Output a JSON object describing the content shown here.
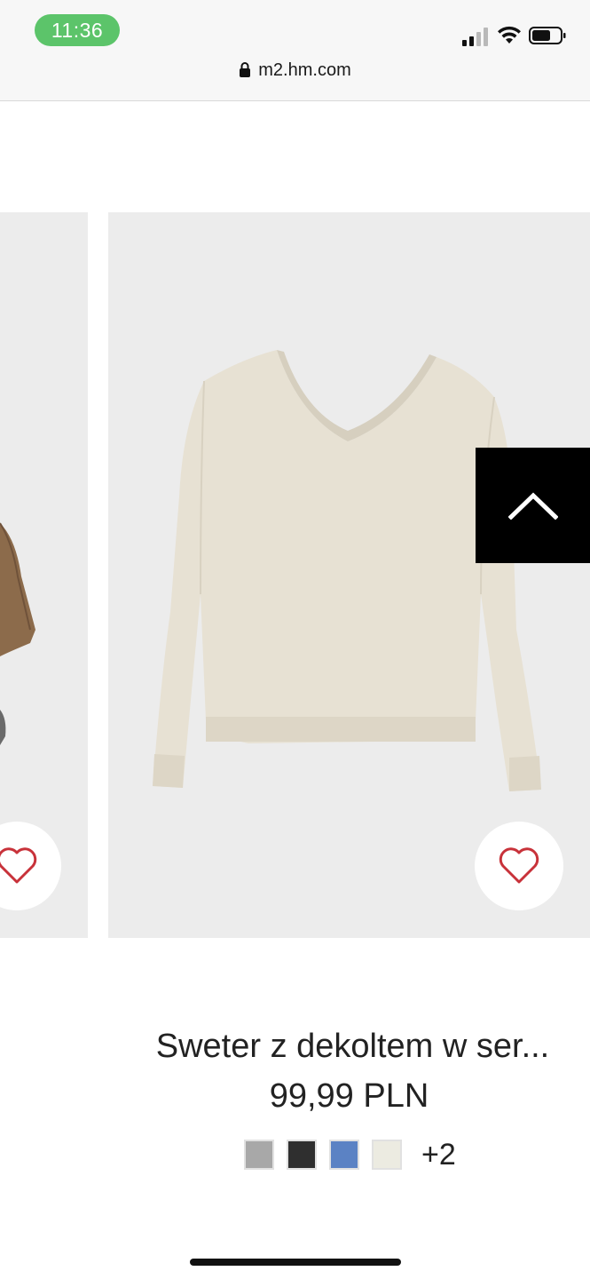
{
  "status_bar": {
    "time": "11:36",
    "url": "m2.hm.com"
  },
  "product": {
    "title": "Sweter z dekoltem w ser...",
    "price": "99,99 PLN",
    "more_colors": "+2",
    "swatch_colors": [
      "#a8a8a8",
      "#2f2f2f",
      "#5b82c4",
      "#ecebe1"
    ]
  },
  "icons": {
    "lock": "lock-icon",
    "signal": "cellular-signal-icon",
    "wifi": "wifi-icon",
    "battery": "battery-icon",
    "favorite": "heart-icon",
    "scroll_top": "chevron-up-icon"
  },
  "colors": {
    "time_pill": "#5cc46a",
    "card_bg": "#ececec",
    "heart": "#c8323a"
  }
}
